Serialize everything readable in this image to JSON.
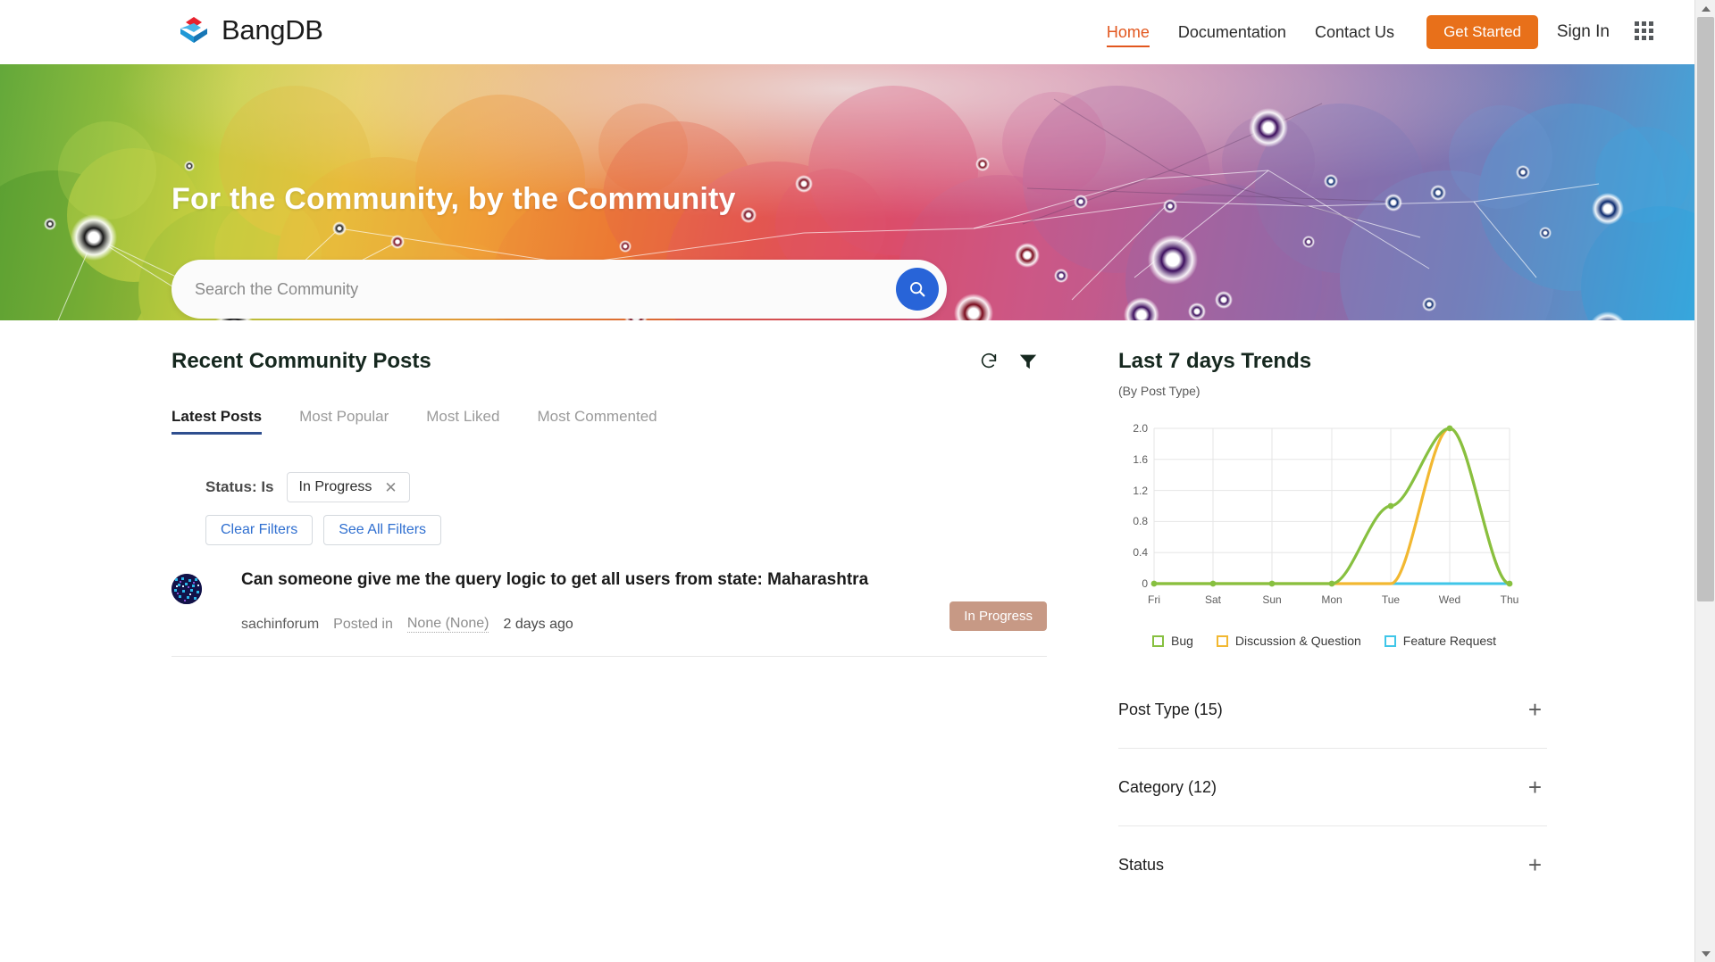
{
  "brand": {
    "name": "BangDB",
    "logo_icon": "bangdb-cube-logo"
  },
  "nav": {
    "links": [
      {
        "label": "Home",
        "active": true
      },
      {
        "label": "Documentation",
        "active": false
      },
      {
        "label": "Contact Us",
        "active": false
      }
    ],
    "get_started_label": "Get Started",
    "sign_in_label": "Sign In",
    "apps_icon": "grid-apps-icon",
    "accent_color": "#e2571e",
    "button_color": "#e8701a"
  },
  "hero": {
    "title": "For the Community, by the Community",
    "search_placeholder": "Search the Community",
    "search_value": "",
    "search_icon": "search-icon",
    "search_button_color": "#2864d8"
  },
  "posts": {
    "heading": "Recent Community Posts",
    "refresh_icon": "refresh-icon",
    "filter_icon": "funnel-filter-icon",
    "tabs": [
      {
        "label": "Latest Posts",
        "active": true
      },
      {
        "label": "Most Popular",
        "active": false
      },
      {
        "label": "Most Liked",
        "active": false
      },
      {
        "label": "Most Commented",
        "active": false
      }
    ],
    "filters": {
      "label": "Status: Is",
      "chip_value": "In Progress",
      "chip_remove_icon": "close-icon",
      "clear_label": "Clear Filters",
      "see_all_label": "See All Filters"
    },
    "items": [
      {
        "title": "Can someone give me the query logic to get all users from state: Maharashtra",
        "author": "sachinforum",
        "posted_in_prefix": "Posted in",
        "posted_in": "None (None)",
        "time": "2 days ago",
        "status": "In Progress",
        "status_color": "#c79985",
        "avatar_icon": "user-avatar"
      }
    ]
  },
  "trends": {
    "title": "Last 7 days Trends",
    "subtitle": "(By Post Type)"
  },
  "chart_data": {
    "type": "line",
    "title": "Last 7 days Trends",
    "subtitle": "(By Post Type)",
    "categories": [
      "Fri",
      "Sat",
      "Sun",
      "Mon",
      "Tue",
      "Wed",
      "Thu"
    ],
    "xlabel": "",
    "ylabel": "",
    "ylim": [
      0,
      2.0
    ],
    "yticks": [
      "0",
      "0.4",
      "0.8",
      "1.2",
      "1.6",
      "2.0"
    ],
    "ytick_values": [
      0,
      0.4,
      0.8,
      1.2,
      1.6,
      2.0
    ],
    "grid": true,
    "legend_position": "bottom",
    "series": [
      {
        "name": "Bug",
        "color": "#87c040",
        "values": [
          0,
          0,
          0,
          0,
          1,
          2,
          0
        ]
      },
      {
        "name": "Discussion & Question",
        "color": "#f2b831",
        "values": [
          0,
          0,
          0,
          0,
          0,
          2,
          0
        ]
      },
      {
        "name": "Feature Request",
        "color": "#3fc6e8",
        "values": [
          0,
          0,
          0,
          0,
          0,
          0,
          0
        ]
      }
    ]
  },
  "facets": [
    {
      "label": "Post Type (15)",
      "expand_icon": "plus-icon"
    },
    {
      "label": "Category (12)",
      "expand_icon": "plus-icon"
    },
    {
      "label": "Status",
      "expand_icon": "plus-icon"
    }
  ],
  "scrollbar": {
    "up_icon": "scroll-up-arrow",
    "down_icon": "scroll-down-arrow"
  }
}
